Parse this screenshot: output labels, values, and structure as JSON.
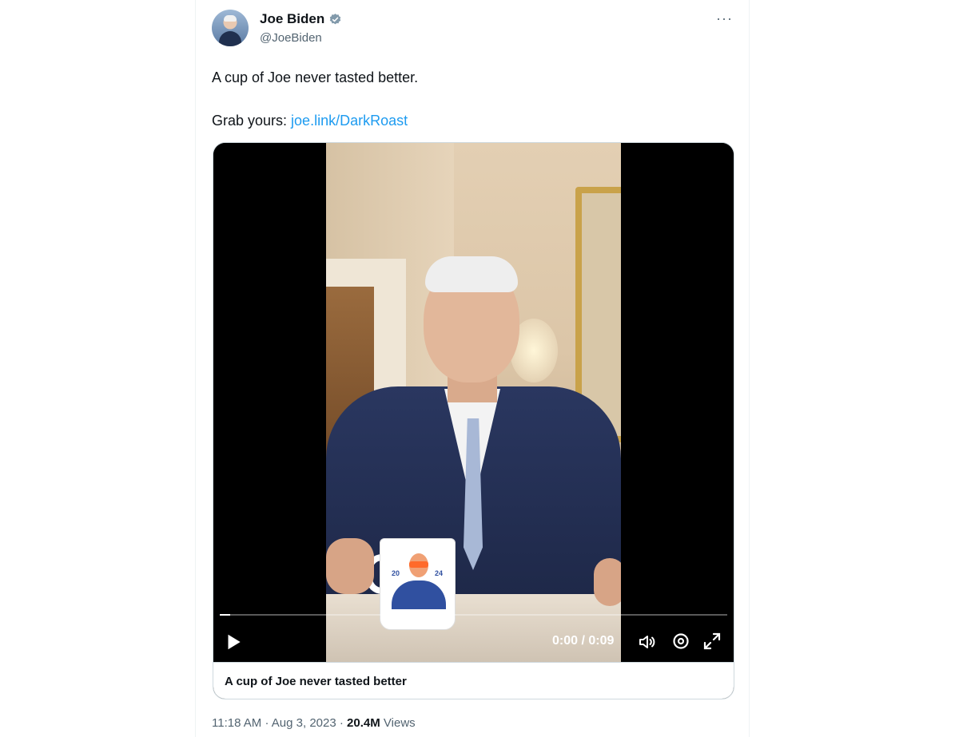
{
  "author": {
    "display_name": "Joe Biden",
    "handle": "@JoeBiden",
    "verified": true
  },
  "tweet": {
    "line1": "A cup of Joe never tasted better.",
    "line2_prefix": "Grab yours: ",
    "link_text": "joe.link/DarkRoast"
  },
  "video": {
    "progress_fraction": 0.02,
    "time_display": "0:00 / 0:09",
    "caption": "A cup of Joe never tasted better",
    "mug_year_left": "20",
    "mug_year_right": "24",
    "icons": [
      "play-icon",
      "volume-icon",
      "settings-icon",
      "fullscreen-icon"
    ]
  },
  "meta": {
    "time": "11:18 AM",
    "separator": "·",
    "date": "Aug 3, 2023",
    "views_count": "20.4M",
    "views_label": "Views"
  },
  "colors": {
    "link": "#1d9bf0",
    "verified": "#829aab",
    "secondary_text": "#536471"
  }
}
